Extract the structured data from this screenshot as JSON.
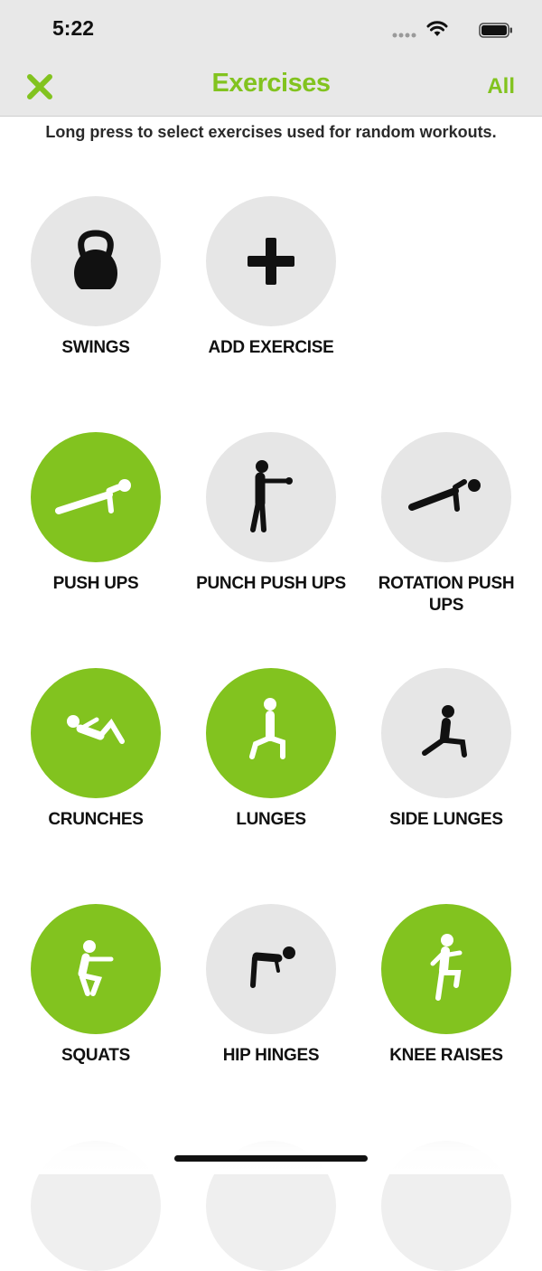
{
  "status_bar": {
    "time": "5:22"
  },
  "nav": {
    "title": "Exercises",
    "all_label": "All",
    "close_icon": "close-x-icon",
    "accent_color": "#82c31f"
  },
  "subtitle": "Long press to select exercises used for random workouts.",
  "exercises": [
    {
      "label": "SWINGS",
      "selected": false,
      "icon": "kettlebell-icon"
    },
    {
      "label": "ADD EXERCISE",
      "selected": false,
      "icon": "plus-icon"
    },
    {
      "label": "PUSH UPS",
      "selected": true,
      "icon": "push-up-icon"
    },
    {
      "label": "PUNCH PUSH UPS",
      "selected": false,
      "icon": "punch-icon"
    },
    {
      "label": "ROTATION PUSH UPS",
      "selected": false,
      "icon": "rotation-push-up-icon"
    },
    {
      "label": "CRUNCHES",
      "selected": true,
      "icon": "crunch-icon"
    },
    {
      "label": "LUNGES",
      "selected": true,
      "icon": "lunge-icon"
    },
    {
      "label": "SIDE LUNGES",
      "selected": false,
      "icon": "side-lunge-icon"
    },
    {
      "label": "SQUATS",
      "selected": true,
      "icon": "squat-icon"
    },
    {
      "label": "HIP HINGES",
      "selected": false,
      "icon": "hip-hinge-icon"
    },
    {
      "label": "KNEE RAISES",
      "selected": true,
      "icon": "knee-raise-icon"
    }
  ]
}
